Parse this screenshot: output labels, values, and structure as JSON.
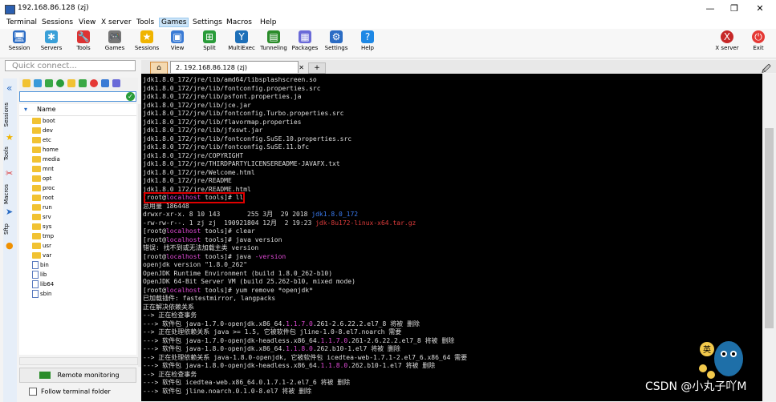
{
  "window": {
    "title": "192.168.86.128 (zj)",
    "controls": [
      "—",
      "❐",
      "✕"
    ]
  },
  "menu": [
    "Terminal",
    "Sessions",
    "View",
    "X server",
    "Tools",
    "Games",
    "Settings",
    "Macros",
    "Help"
  ],
  "menu_active": "Games",
  "toolbar": [
    {
      "label": "Session",
      "icon": "session-icon",
      "color": "#2b6cc4",
      "glyph": "🖥"
    },
    {
      "label": "Servers",
      "icon": "servers-icon",
      "color": "#3aa0d8",
      "glyph": "✱"
    },
    {
      "label": "Tools",
      "icon": "tools-icon",
      "color": "#d33",
      "glyph": "🔧"
    },
    {
      "label": "Games",
      "icon": "games-icon",
      "color": "#777",
      "glyph": "🎮"
    },
    {
      "label": "Sessions",
      "icon": "star-icon",
      "color": "#f0b400",
      "glyph": "★"
    },
    {
      "label": "View",
      "icon": "view-icon",
      "color": "#3a7bd5",
      "glyph": "▣"
    },
    {
      "label": "Split",
      "icon": "split-icon",
      "color": "#2a9c3a",
      "glyph": "⊞"
    },
    {
      "label": "MultiExec",
      "icon": "multiexec-icon",
      "color": "#1d6fb8",
      "glyph": "Y"
    },
    {
      "label": "Tunneling",
      "icon": "tunneling-icon",
      "color": "#2a8c2a",
      "glyph": "▤"
    },
    {
      "label": "Packages",
      "icon": "packages-icon",
      "color": "#6a6ad8",
      "glyph": "▦"
    },
    {
      "label": "Settings",
      "icon": "gear-icon",
      "color": "#2b6cc4",
      "glyph": "⚙"
    },
    {
      "label": "Help",
      "icon": "help-icon",
      "color": "#1e88e5",
      "glyph": "?"
    }
  ],
  "toolbar_right": [
    {
      "label": "X server",
      "icon": "xserver-icon",
      "color": "#c62828",
      "glyph": "X"
    },
    {
      "label": "Exit",
      "icon": "power-icon",
      "color": "#e53935",
      "glyph": "⏻"
    }
  ],
  "quick_connect": {
    "placeholder": "Quick connect..."
  },
  "tabs": {
    "home_glyph": "⌂",
    "active": "2. 192.168.86.128 (zj)",
    "close": "✕",
    "new_glyph": "+",
    "clip_glyph": "🖉"
  },
  "side_tabs": [
    "Sessions",
    "Tools",
    "Macros",
    "Sftp"
  ],
  "file_panel": {
    "column_header": "Name",
    "items": [
      {
        "name": "boot",
        "type": "folder"
      },
      {
        "name": "dev",
        "type": "folder"
      },
      {
        "name": "etc",
        "type": "folder"
      },
      {
        "name": "home",
        "type": "folder"
      },
      {
        "name": "media",
        "type": "folder"
      },
      {
        "name": "mnt",
        "type": "folder"
      },
      {
        "name": "opt",
        "type": "folder"
      },
      {
        "name": "proc",
        "type": "folder"
      },
      {
        "name": "root",
        "type": "folder"
      },
      {
        "name": "run",
        "type": "folder"
      },
      {
        "name": "srv",
        "type": "folder"
      },
      {
        "name": "sys",
        "type": "folder"
      },
      {
        "name": "tmp",
        "type": "folder"
      },
      {
        "name": "usr",
        "type": "folder"
      },
      {
        "name": "var",
        "type": "folder"
      },
      {
        "name": "bin",
        "type": "file"
      },
      {
        "name": "lib",
        "type": "file"
      },
      {
        "name": "lib64",
        "type": "file"
      },
      {
        "name": "sbin",
        "type": "file"
      }
    ],
    "remote_monitoring": "Remote monitoring",
    "follow_folder": "Follow terminal folder"
  },
  "terminal_lines": [
    [
      {
        "t": "jdk1.8.0_172/jre/lib/amd64/libsplashscreen.so"
      }
    ],
    [
      {
        "t": "jdk1.8.0_172/jre/lib/fontconfig.properties.src"
      }
    ],
    [
      {
        "t": "jdk1.8.0_172/jre/lib/psfont.properties.ja"
      }
    ],
    [
      {
        "t": "jdk1.8.0_172/jre/lib/jce.jar"
      }
    ],
    [
      {
        "t": "jdk1.8.0_172/jre/lib/fontconfig.Turbo.properties.src"
      }
    ],
    [
      {
        "t": "jdk1.8.0_172/jre/lib/flavormap.properties"
      }
    ],
    [
      {
        "t": "jdk1.8.0_172/jre/lib/jfxswt.jar"
      }
    ],
    [
      {
        "t": "jdk1.8.0_172/jre/lib/fontconfig.SuSE.10.properties.src"
      }
    ],
    [
      {
        "t": "jdk1.8.0_172/jre/lib/fontconfig.SuSE.11.bfc"
      }
    ],
    [
      {
        "t": "jdk1.8.0_172/jre/COPYRIGHT"
      }
    ],
    [
      {
        "t": "jdk1.8.0_172/jre/THIRDPARTYLICENSEREADME-JAVAFX.txt"
      }
    ],
    [
      {
        "t": "jdk1.8.0_172/jre/Welcome.html"
      }
    ],
    [
      {
        "t": "jdk1.8.0_172/jre/README"
      }
    ],
    [
      {
        "t": "jdk1.8.0_172/jre/README.html"
      }
    ],
    [
      {
        "t": "[root@"
      },
      {
        "t": "localhost",
        "c": "#e04ad6"
      },
      {
        "t": " tools]# ll"
      }
    ],
    [
      {
        "t": "总用量 186448"
      }
    ],
    [
      {
        "t": "drwxr-xr-x. 8 10 143       255 3月  29 2018 "
      },
      {
        "t": "jdk1.8.0_172",
        "c": "#3a7bf0"
      }
    ],
    [
      {
        "t": "-rw-rw-r--. 1 zj zj  190921804 12月  2 19:23 "
      },
      {
        "t": "jdk-8u172-linux-x64.tar.gz",
        "c": "#e03c3c"
      }
    ],
    [
      {
        "t": "[root@"
      },
      {
        "t": "localhost",
        "c": "#e04ad6"
      },
      {
        "t": " tools]# clear"
      }
    ],
    [
      {
        "t": "[root@"
      },
      {
        "t": "localhost",
        "c": "#e04ad6"
      },
      {
        "t": " tools]# java version"
      }
    ],
    [
      {
        "t": "错误: 找不到或无法加载主类 version"
      }
    ],
    [
      {
        "t": "[root@"
      },
      {
        "t": "localhost",
        "c": "#e04ad6"
      },
      {
        "t": " tools]# java "
      },
      {
        "t": "-version",
        "c": "#e04ad6"
      }
    ],
    [
      {
        "t": "openjdk version \"1.8.0_262\""
      }
    ],
    [
      {
        "t": "OpenJDK Runtime Environment (build 1.8.0_262-b10)"
      }
    ],
    [
      {
        "t": "OpenJDK 64-Bit Server VM (build 25.262-b10, mixed mode)"
      }
    ],
    [
      {
        "t": "[root@"
      },
      {
        "t": "localhost",
        "c": "#e04ad6"
      },
      {
        "t": " tools]# yum remove *openjdk*"
      }
    ],
    [
      {
        "t": "已加载插件: fastestmirror, langpacks"
      }
    ],
    [
      {
        "t": "正在解决依赖关系"
      }
    ],
    [
      {
        "t": "--> 正在检查事务"
      }
    ],
    [
      {
        "t": "---> 软件包 java-1.7.0-openjdk.x86_64."
      },
      {
        "t": "1.1.7.0",
        "c": "#e04ad6"
      },
      {
        "t": ".261-2.6.22.2.el7_8 将被 删除"
      }
    ],
    [
      {
        "t": "--> 正在处理依赖关系 java >= 1.5, 它被软件包 jline-1.0-8.el7.noarch 需要"
      }
    ],
    [
      {
        "t": "---> 软件包 java-1.7.0-openjdk-headless.x86_64."
      },
      {
        "t": "1.1.7.0",
        "c": "#e04ad6"
      },
      {
        "t": ".261-2.6.22.2.el7_8 将被 删除"
      }
    ],
    [
      {
        "t": "---> 软件包 java-1.8.0-openjdk.x86_64."
      },
      {
        "t": "1.1.8.0",
        "c": "#e04ad6"
      },
      {
        "t": ".262.b10-1.el7 将被 删除"
      }
    ],
    [
      {
        "t": "--> 正在处理依赖关系 java-1.8.0-openjdk, 它被软件包 icedtea-web-1.7.1-2.el7_6.x86_64 需要"
      }
    ],
    [
      {
        "t": "---> 软件包 java-1.8.0-openjdk-headless.x86_64."
      },
      {
        "t": "1.1.8.0",
        "c": "#e04ad6"
      },
      {
        "t": ".262.b10-1.el7 将被 删除"
      }
    ],
    [
      {
        "t": "--> 正在检查事务"
      }
    ],
    [
      {
        "t": "---> 软件包 icedtea-web.x86_64.0.1.7.1-2.el7_6 将被 删除"
      }
    ],
    [
      {
        "t": "---> 软件包 jline.noarch.0.1.0-8.el7 将被 删除"
      }
    ]
  ],
  "watermark": "CSDN @小丸子吖M",
  "colors": {
    "terminal_bg": "#000000",
    "terminal_fg": "#dddddd",
    "prompt_host": "#e04ad6",
    "highlight_box": "#e00000"
  }
}
